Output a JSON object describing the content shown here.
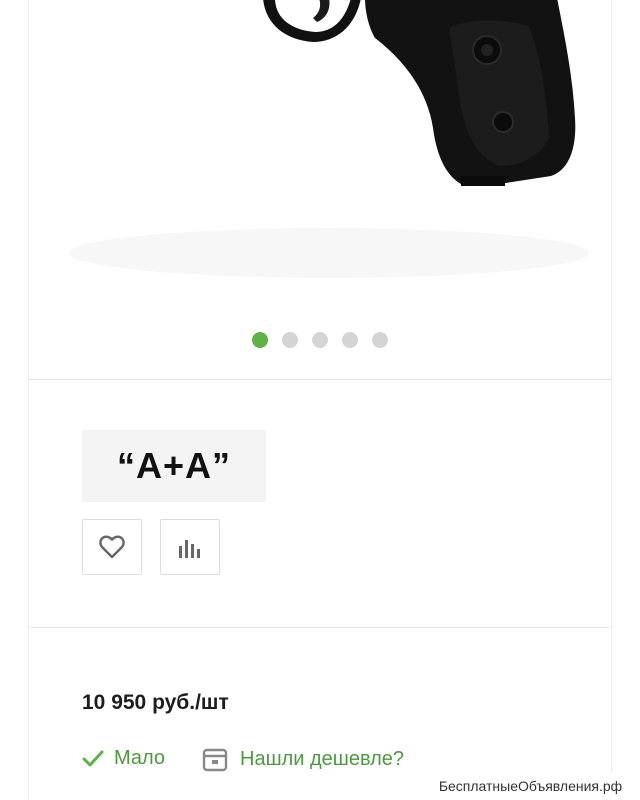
{
  "gallery": {
    "image_icon": "pistol-image",
    "dots_total": 5,
    "active_index": 0
  },
  "brand": {
    "logo_text": "“A+A”"
  },
  "actions": {
    "favorite_icon": "heart-icon",
    "compare_icon": "bar-chart-icon"
  },
  "price": {
    "text": "10 950 руб./шт"
  },
  "stock": {
    "icon": "check-icon",
    "label": "Мало"
  },
  "cheaper": {
    "icon": "calendar-icon",
    "label": "Нашли дешевле?"
  },
  "watermark": {
    "text": "БесплатныеОбъявления.рф"
  },
  "colors": {
    "accent_green": "#5fb246",
    "text_green": "#4c9a3e",
    "dot_inactive": "#d4d4d4"
  }
}
